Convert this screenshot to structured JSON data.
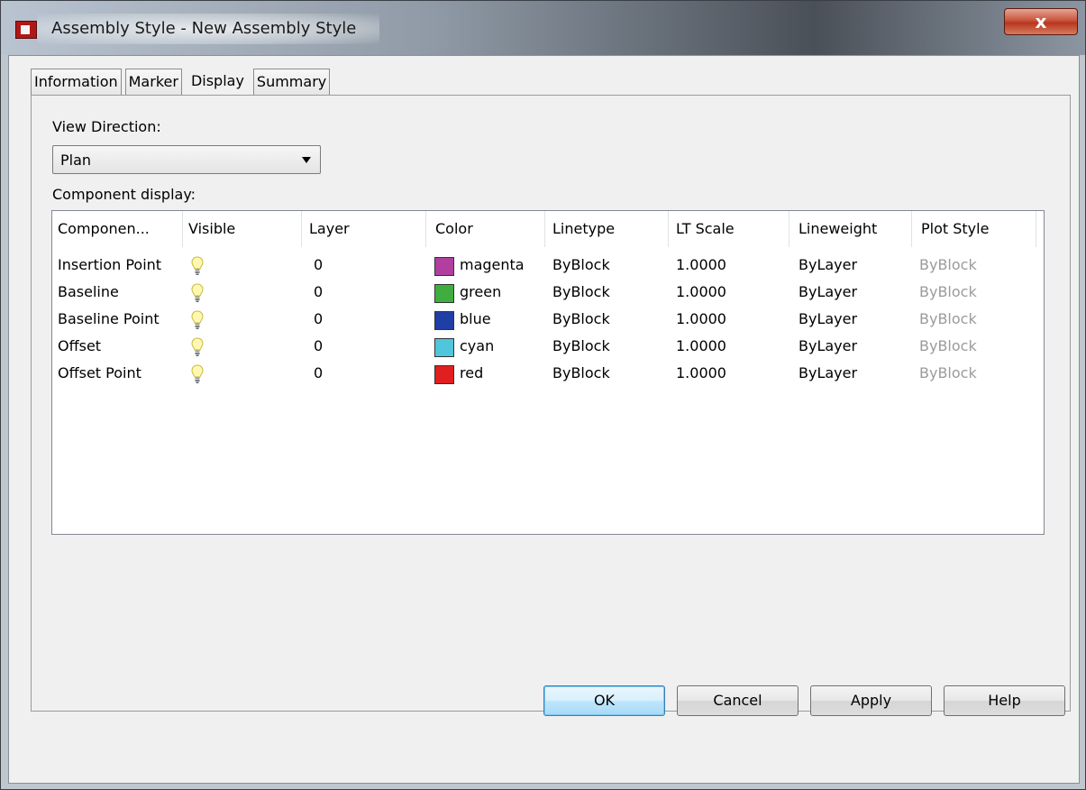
{
  "window": {
    "title": "Assembly Style - New Assembly Style",
    "close_label": "x"
  },
  "tabs": [
    {
      "label": "Information",
      "active": false
    },
    {
      "label": "Marker",
      "active": false
    },
    {
      "label": "Display",
      "active": true
    },
    {
      "label": "Summary",
      "active": false
    }
  ],
  "view_direction": {
    "label": "View Direction:",
    "value": "Plan"
  },
  "component_display": {
    "label": "Component display:",
    "columns": [
      "Componen...",
      "Visible",
      "Layer",
      "Color",
      "Linetype",
      "LT Scale",
      "Lineweight",
      "Plot Style"
    ],
    "rows": [
      {
        "component": "Insertion Point",
        "visible": "lightbulb-on-icon",
        "layer": "0",
        "color_name": "magenta",
        "color_hex": "#b03fa0",
        "linetype": "ByBlock",
        "lt_scale": "1.0000",
        "lineweight": "ByLayer",
        "plot_style": "ByBlock"
      },
      {
        "component": "Baseline",
        "visible": "lightbulb-on-icon",
        "layer": "0",
        "color_name": "green",
        "color_hex": "#3fae3f",
        "linetype": "ByBlock",
        "lt_scale": "1.0000",
        "lineweight": "ByLayer",
        "plot_style": "ByBlock"
      },
      {
        "component": "Baseline Point",
        "visible": "lightbulb-on-icon",
        "layer": "0",
        "color_name": "blue",
        "color_hex": "#1f3fa6",
        "linetype": "ByBlock",
        "lt_scale": "1.0000",
        "lineweight": "ByLayer",
        "plot_style": "ByBlock"
      },
      {
        "component": "Offset",
        "visible": "lightbulb-on-icon",
        "layer": "0",
        "color_name": "cyan",
        "color_hex": "#4fc6dc",
        "linetype": "ByBlock",
        "lt_scale": "1.0000",
        "lineweight": "ByLayer",
        "plot_style": "ByBlock"
      },
      {
        "component": "Offset Point",
        "visible": "lightbulb-on-icon",
        "layer": "0",
        "color_name": "red",
        "color_hex": "#e01f1f",
        "linetype": "ByBlock",
        "lt_scale": "1.0000",
        "lineweight": "ByLayer",
        "plot_style": "ByBlock"
      }
    ]
  },
  "buttons": {
    "ok": "OK",
    "cancel": "Cancel",
    "apply": "Apply",
    "help": "Help"
  }
}
